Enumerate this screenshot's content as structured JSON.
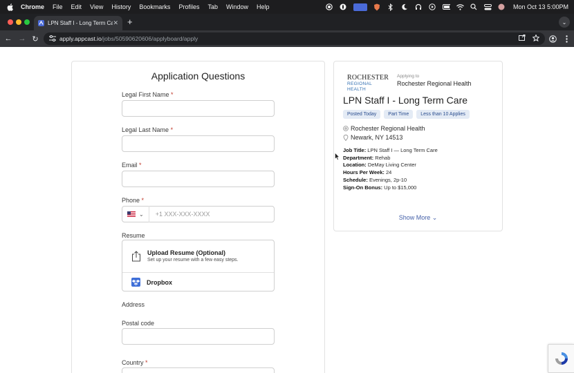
{
  "menubar": {
    "items": [
      "Chrome",
      "File",
      "Edit",
      "View",
      "History",
      "Bookmarks",
      "Profiles",
      "Tab",
      "Window",
      "Help"
    ],
    "clock": "Mon Oct 13  5:00PM"
  },
  "tab": {
    "title": "LPN Staff I - Long Term Care",
    "close": "✕",
    "new_tab": "+"
  },
  "toolbar": {
    "url_domain": "apply.appcast.io",
    "url_path": "/jobs/50590620606/applyboard/apply"
  },
  "form": {
    "title": "Application Questions",
    "required_mark": "*",
    "first_name_label": "Legal First Name",
    "last_name_label": "Legal Last Name",
    "email_label": "Email",
    "phone_label": "Phone",
    "phone_placeholder": "+1 XXX-XXX-XXXX",
    "resume_label": "Resume",
    "upload_title": "Upload Resume (Optional)",
    "upload_subtitle": "Set up your resume with a few easy steps.",
    "dropbox_label": "Dropbox",
    "address_label": "Address",
    "postal_label": "Postal code",
    "country_label": "Country"
  },
  "job": {
    "logo_line1": "ROCHESTER",
    "logo_line2": "REGIONAL HEALTH",
    "applying_to": "Applying to",
    "org": "Rochester Regional Health",
    "title": "LPN Staff I - Long Term Care",
    "chips": [
      "Posted Today",
      "Part Time",
      "Less than 10 Applies"
    ],
    "company": "Rochester Regional Health",
    "location": "Newark, NY 14513",
    "details": [
      {
        "k": "Job Title:",
        "v": "LPN Staff I — Long Term Care"
      },
      {
        "k": "Department:",
        "v": "Rehab"
      },
      {
        "k": "Location:",
        "v": "DeMay Living Center"
      },
      {
        "k": "Hours Per Week:",
        "v": "24"
      },
      {
        "k": "Schedule:",
        "v": "Evenings, 2p-10"
      },
      {
        "k": "Sign-On Bonus:",
        "v": "Up to $15,000"
      }
    ],
    "show_more": "Show More"
  }
}
